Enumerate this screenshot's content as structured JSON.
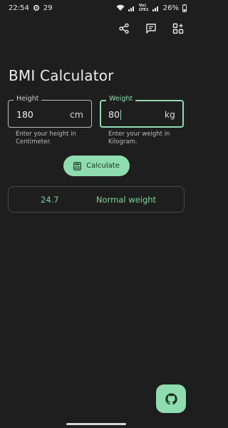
{
  "status_bar": {
    "time": "22:54",
    "notification_count": "29",
    "network_label_top": "Vo)",
    "network_label_bottom": "LTE1",
    "battery": "26%"
  },
  "toolbar": {
    "share_icon": "share-icon",
    "feedback_icon": "chat-icon",
    "more_apps_icon": "apps-add-icon"
  },
  "title": "BMI Calculator",
  "height_field": {
    "label": "Height",
    "value": "180",
    "unit": "cm",
    "helper": "Enter your height in Centimeter."
  },
  "weight_field": {
    "label": "Weight",
    "value": "80",
    "unit": "kg",
    "helper": "Enter your weight in Kilogram."
  },
  "calculate_button": {
    "label": "Calculate",
    "icon": "calculator-icon"
  },
  "result": {
    "bmi": "24.7",
    "category": "Normal weight"
  },
  "fab": {
    "icon": "github-icon"
  },
  "colors": {
    "background": "#1e1e1e",
    "accent": "#8fdcb0",
    "result_text": "#7fd4a0"
  }
}
